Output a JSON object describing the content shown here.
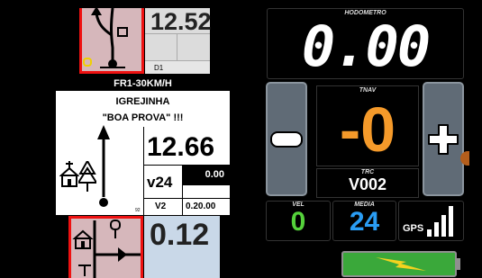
{
  "roadbook": {
    "top": {
      "distance": "12.52",
      "tag": "D1"
    },
    "speed_limit": "FR1-30KM/H",
    "current": {
      "line1": "IGREJINHA",
      "line2": "\"BOA PROVA\" !!!",
      "distance": "12.66",
      "speed_tag": "v24",
      "speed_value": "0.00",
      "v2_tag": "V2",
      "v2_time": "0.20.00",
      "index": "92"
    },
    "next": {
      "distance": "0.12"
    }
  },
  "dash": {
    "hodometro_label": "HODOMETRO",
    "hodometro_value": "0.00",
    "tnav_label": "TNAV",
    "tnav_value": "-0",
    "trc_label": "TRC",
    "trc_value": "V002",
    "vel_label": "VEL",
    "vel_value": "0",
    "media_label": "MEDIA",
    "media_value": "24",
    "gps_label": "GPS",
    "gps_bars": 4
  },
  "colors": {
    "tnav": "#f59a2a",
    "vel": "#55d23b",
    "media": "#2a9df4",
    "roadbook_highlight": "#e11111",
    "battery": "#3aa83a",
    "bolt": "#f4d21f"
  },
  "icons": [
    "minus-icon",
    "plus-icon",
    "gps-signal-icon",
    "battery-icon",
    "lightning-icon",
    "church-icon",
    "tree-icon",
    "road-arrow-icon",
    "junction-icon"
  ]
}
